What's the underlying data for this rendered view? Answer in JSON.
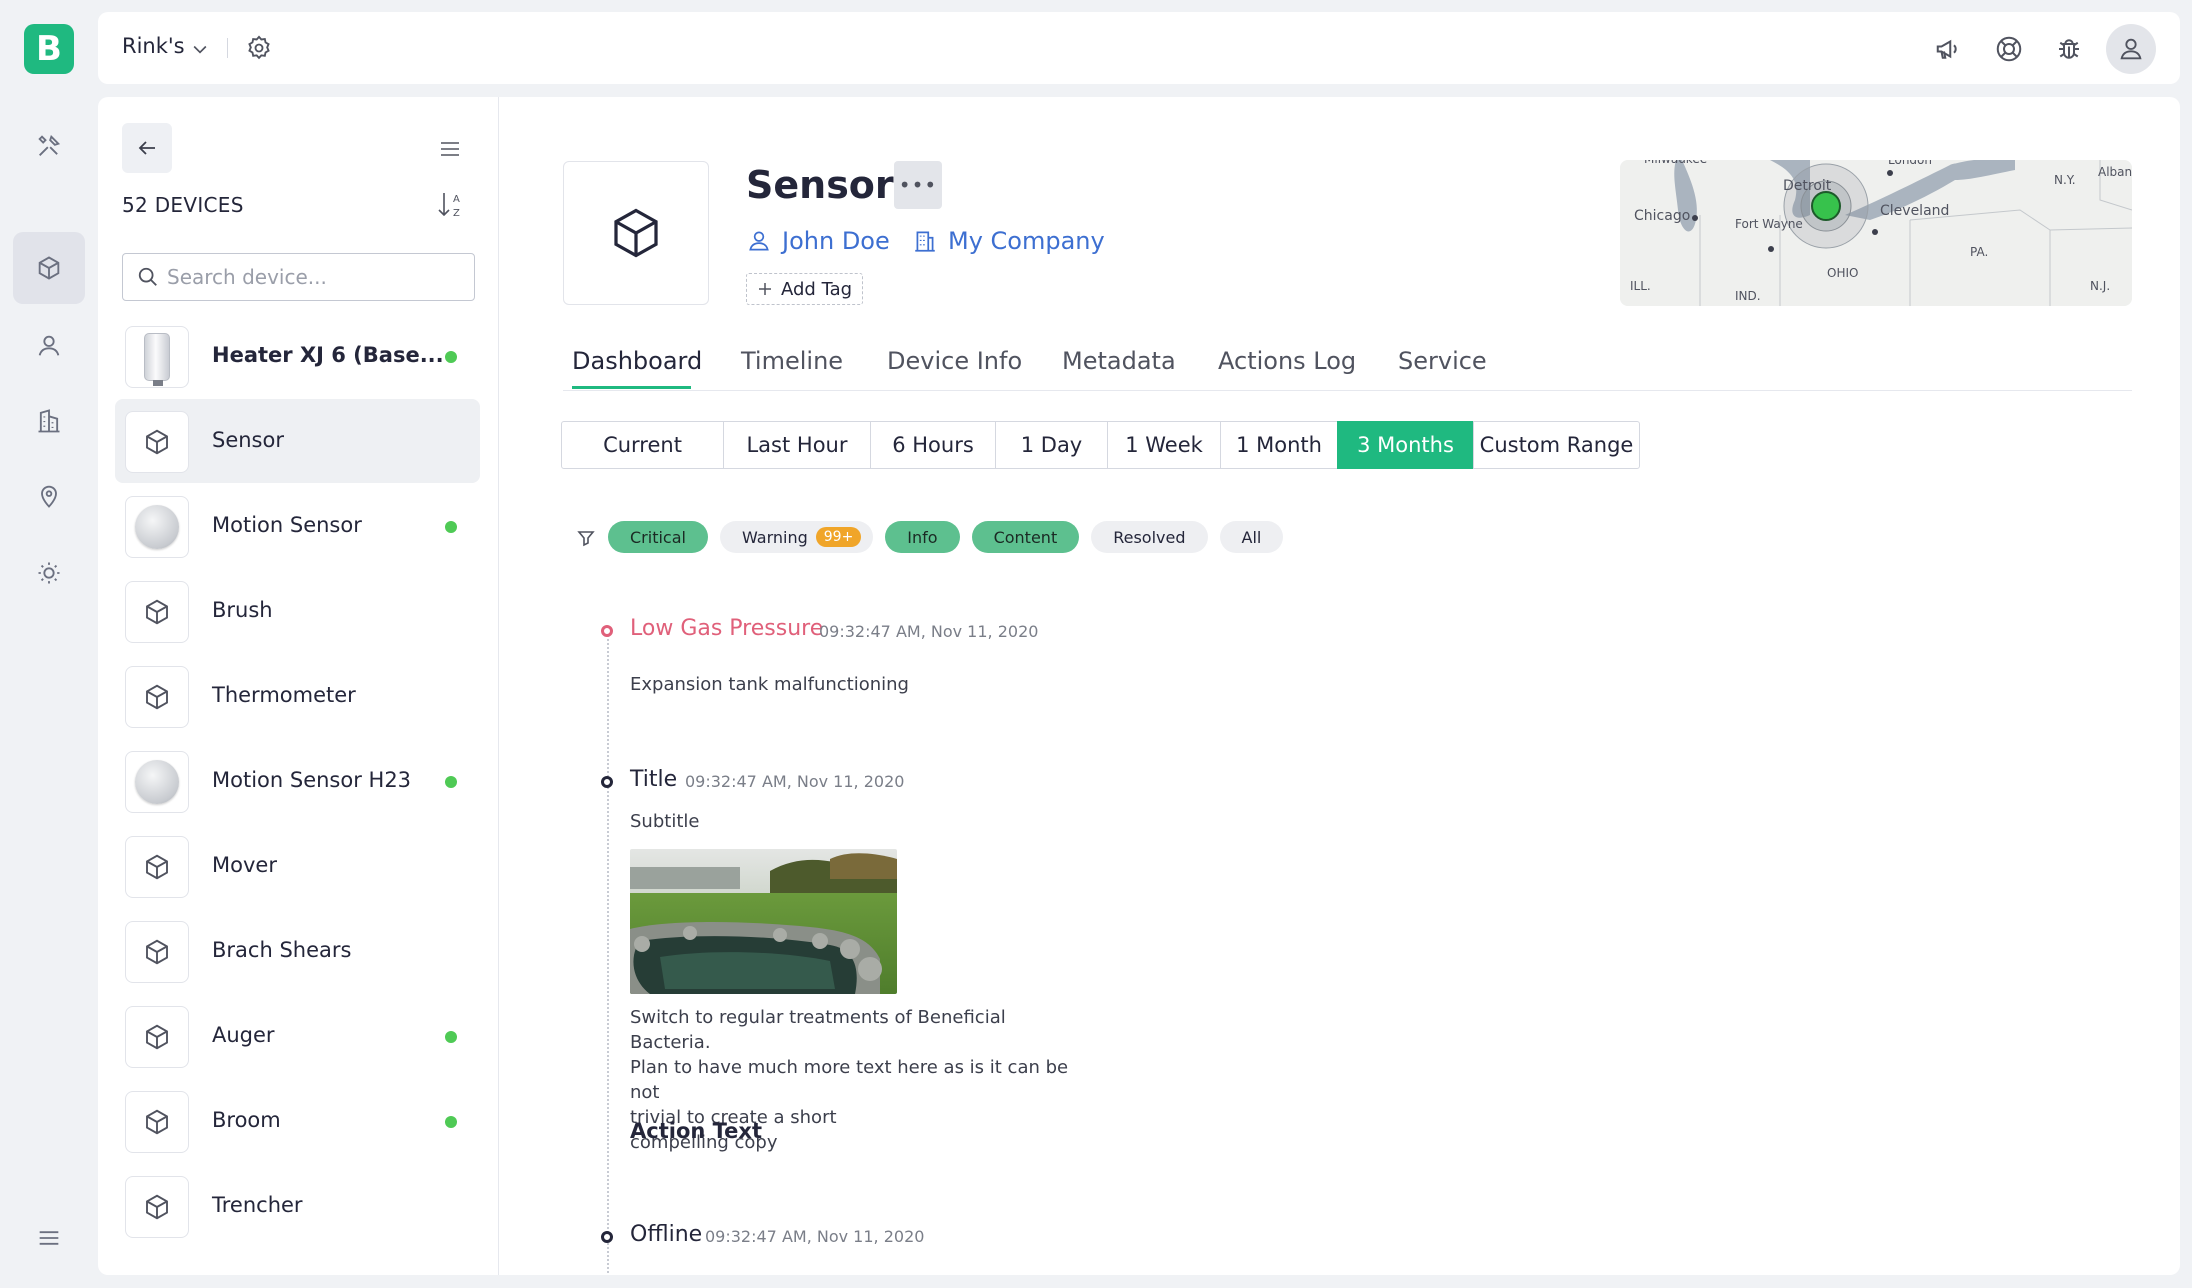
{
  "app": {
    "logo_letter": "B",
    "brand_color": "#1fb980"
  },
  "header": {
    "org_name": "Rink's",
    "icons": [
      "megaphone-icon",
      "lifebuoy-icon",
      "bug-icon",
      "user-avatar-icon"
    ]
  },
  "rail": {
    "items": [
      "tools-icon",
      "devices-icon",
      "users-icon",
      "buildings-icon",
      "location-icon",
      "theme-icon"
    ],
    "active": "devices-icon"
  },
  "devices": {
    "count_label": "52 DEVICES",
    "search_placeholder": "Search device...",
    "items": [
      {
        "name": "Heater XJ 6 (Base...",
        "thumb": "heater",
        "online": true,
        "bold": true
      },
      {
        "name": "Sensor",
        "thumb": "cube",
        "online": false,
        "active": true
      },
      {
        "name": "Motion Sensor",
        "thumb": "motion",
        "online": true
      },
      {
        "name": "Brush",
        "thumb": "cube",
        "online": false
      },
      {
        "name": "Thermometer",
        "thumb": "cube",
        "online": false
      },
      {
        "name": "Motion Sensor H23",
        "thumb": "motion",
        "online": true
      },
      {
        "name": "Mover",
        "thumb": "cube",
        "online": false
      },
      {
        "name": "Brach Shears",
        "thumb": "cube",
        "online": false
      },
      {
        "name": "Auger",
        "thumb": "cube",
        "online": true
      },
      {
        "name": "Broom",
        "thumb": "cube",
        "online": true
      },
      {
        "name": "Trencher",
        "thumb": "cube",
        "online": false
      }
    ]
  },
  "device": {
    "title": "Sensor",
    "more_label": "•••",
    "owner": "John Doe",
    "company": "My Company",
    "add_tag": "Add Tag"
  },
  "map": {
    "labels": [
      "Milwaukee",
      "London",
      "Detroit",
      "N.Y.",
      "Alban",
      "Chicago",
      "Fort Wayne",
      "Cleveland",
      "PA.",
      "OHIO",
      "ILL.",
      "IND.",
      "N.J."
    ]
  },
  "tabs": [
    "Dashboard",
    "Timeline",
    "Device Info",
    "Metadata",
    "Actions Log",
    "Service"
  ],
  "active_tab": "Dashboard",
  "ranges": [
    "Current",
    "Last Hour",
    "6 Hours",
    "1 Day",
    "1 Week",
    "1 Month",
    "3 Months",
    "Custom Range"
  ],
  "selected_range": "3 Months",
  "filters": {
    "chips": [
      {
        "label": "Critical",
        "selected": true
      },
      {
        "label": "Warning",
        "badge": "99+",
        "selected": false
      },
      {
        "label": "Info",
        "selected": true
      },
      {
        "label": "Content",
        "selected": true
      },
      {
        "label": "Resolved",
        "selected": false
      },
      {
        "label": "All",
        "selected": false
      }
    ]
  },
  "timeline": [
    {
      "title": "Low Gas Pressure",
      "time": "09:32:47 AM, Nov 11, 2020",
      "severity": "critical",
      "text": "Expansion tank malfunctioning"
    },
    {
      "title": "Title",
      "time": "09:32:47 AM, Nov 11, 2020",
      "subtitle": "Subtitle",
      "body_lines": [
        "Switch to regular treatments of Beneficial Bacteria.",
        "Plan to have much more text here as is it can be not",
        "trivial to create a short",
        "compelling copy"
      ],
      "action": "Action Text"
    },
    {
      "title": "Offline",
      "time": "09:32:47 AM, Nov 11, 2020"
    }
  ]
}
